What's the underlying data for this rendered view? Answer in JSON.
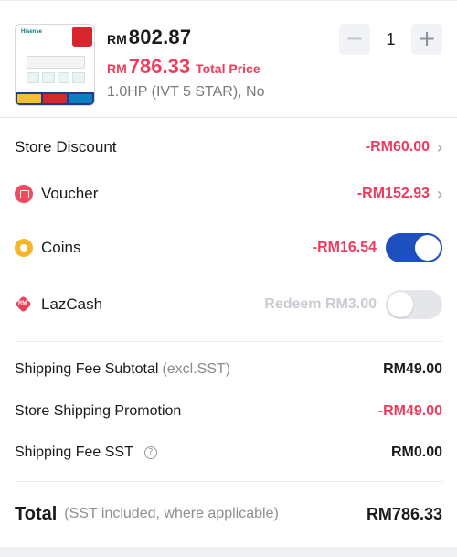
{
  "product": {
    "image_alt": "Hisense air conditioner product image",
    "image_brand": "Hisense",
    "currency": "RM",
    "original_price": "802.87",
    "final_price": "786.33",
    "final_price_label": "Total Price",
    "variant": "1.0HP (IVT 5 STAR), No",
    "quantity": "1",
    "minus_icon": "minus-icon",
    "plus_icon": "plus-icon"
  },
  "discounts": {
    "store_discount": {
      "label": "Store Discount",
      "value": "-RM60.00",
      "icon": "chevron-right-icon"
    },
    "voucher": {
      "label": "Voucher",
      "value": "-RM152.93",
      "icon": "voucher-icon"
    },
    "coins": {
      "label": "Coins",
      "value": "-RM16.54",
      "icon": "coin-icon",
      "toggle_on": true
    },
    "lazcash": {
      "label": "LazCash",
      "value": "Redeem RM3.00",
      "icon": "lazcash-icon",
      "toggle_on": false
    }
  },
  "shipping": {
    "subtotal": {
      "label": "Shipping Fee Subtotal",
      "sub": "(excl.SST)",
      "value": "RM49.00"
    },
    "promotion": {
      "label": "Store Shipping Promotion",
      "value": "-RM49.00"
    },
    "sst": {
      "label": "Shipping Fee SST",
      "value": "RM0.00",
      "icon": "question-icon"
    }
  },
  "total": {
    "label": "Total",
    "note": "(SST included, where applicable)",
    "value": "RM786.33"
  },
  "colors": {
    "accent_red": "#ee3a5d",
    "toggle_blue": "#1d4fbf",
    "coin_yellow": "#f7b62a"
  }
}
